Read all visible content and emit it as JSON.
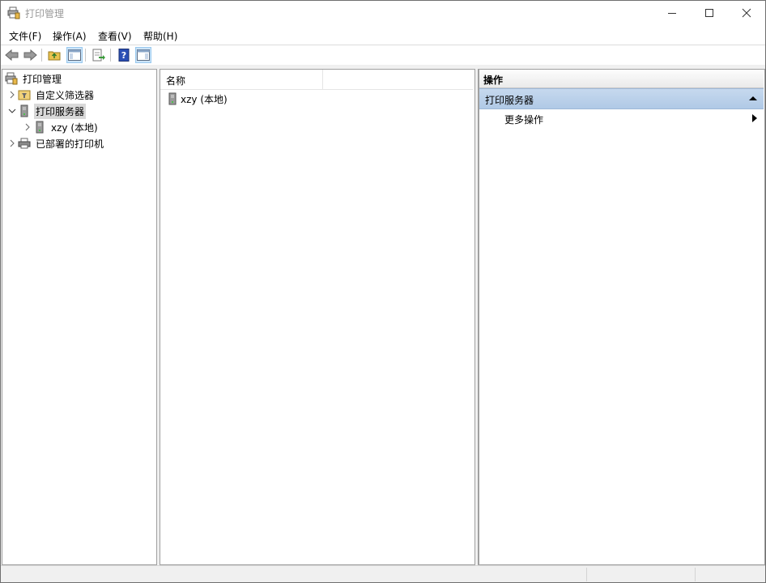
{
  "window": {
    "title": "打印管理"
  },
  "menu": {
    "file": "文件(F)",
    "action": "操作(A)",
    "view": "查看(V)",
    "help": "帮助(H)"
  },
  "toolbar": [
    "back-icon",
    "forward-icon",
    "up-folder-icon",
    "show-hide-tree-icon",
    "export-list-icon",
    "help-icon",
    "show-hide-action-pane-icon"
  ],
  "tree": {
    "root": "打印管理",
    "custom_filters": "自定义筛选器",
    "print_servers": "打印服务器",
    "server_local": "xzy (本地)",
    "deployed_printers": "已部署的打印机"
  },
  "list": {
    "columns": [
      "名称"
    ],
    "rows": [
      "xzy (本地)"
    ]
  },
  "actions": {
    "title": "操作",
    "group": "打印服务器",
    "more": "更多操作"
  },
  "colors": {
    "selection": "#d9d9d9",
    "action_group_bg": "#b8cfe9",
    "active_toolbar": "#cce4f7"
  }
}
